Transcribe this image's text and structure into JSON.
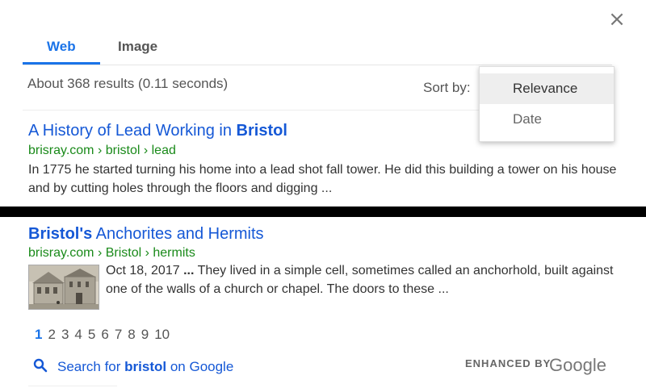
{
  "close_label": "×",
  "tabs": [
    {
      "label": "Web",
      "active": true
    },
    {
      "label": "Image",
      "active": false
    }
  ],
  "results_info": "About 368 results (0.11 seconds)",
  "sort": {
    "label": "Sort by:",
    "options": [
      "Relevance",
      "Date"
    ],
    "selected": "Relevance"
  },
  "results": [
    {
      "title_prefix": "A History of Lead Working in ",
      "title_bold": "Bristol",
      "url": "brisray.com › bristol › lead",
      "snippet": "In 1775 he started turning his home into a lead shot fall tower. He did this building a tower on his house and by cutting holes through the floors and digging ..."
    },
    {
      "title_bold": "Bristol's",
      "title_suffix": " Anchorites and Hermits",
      "url": "brisray.com › Bristol › hermits",
      "snippet_date": "Oct 18, 2017",
      "snippet_ellipsis": " ...",
      "snippet": " They lived in a simple cell, sometimes called an anchorhold, built against one of the walls of a church or chapel. The doors to these ..."
    }
  ],
  "pagination": {
    "pages": [
      "1",
      "2",
      "3",
      "4",
      "5",
      "6",
      "7",
      "8",
      "9",
      "10"
    ],
    "current": "1"
  },
  "search_google": {
    "prefix": "Search for ",
    "term": "bristol",
    "suffix": " on Google"
  },
  "branding": {
    "enhanced_by": "ENHANCED BY",
    "google": "Google"
  },
  "colors": {
    "accent": "#1a73e8",
    "link": "#1558d6",
    "url_green": "#1a8a1a"
  }
}
